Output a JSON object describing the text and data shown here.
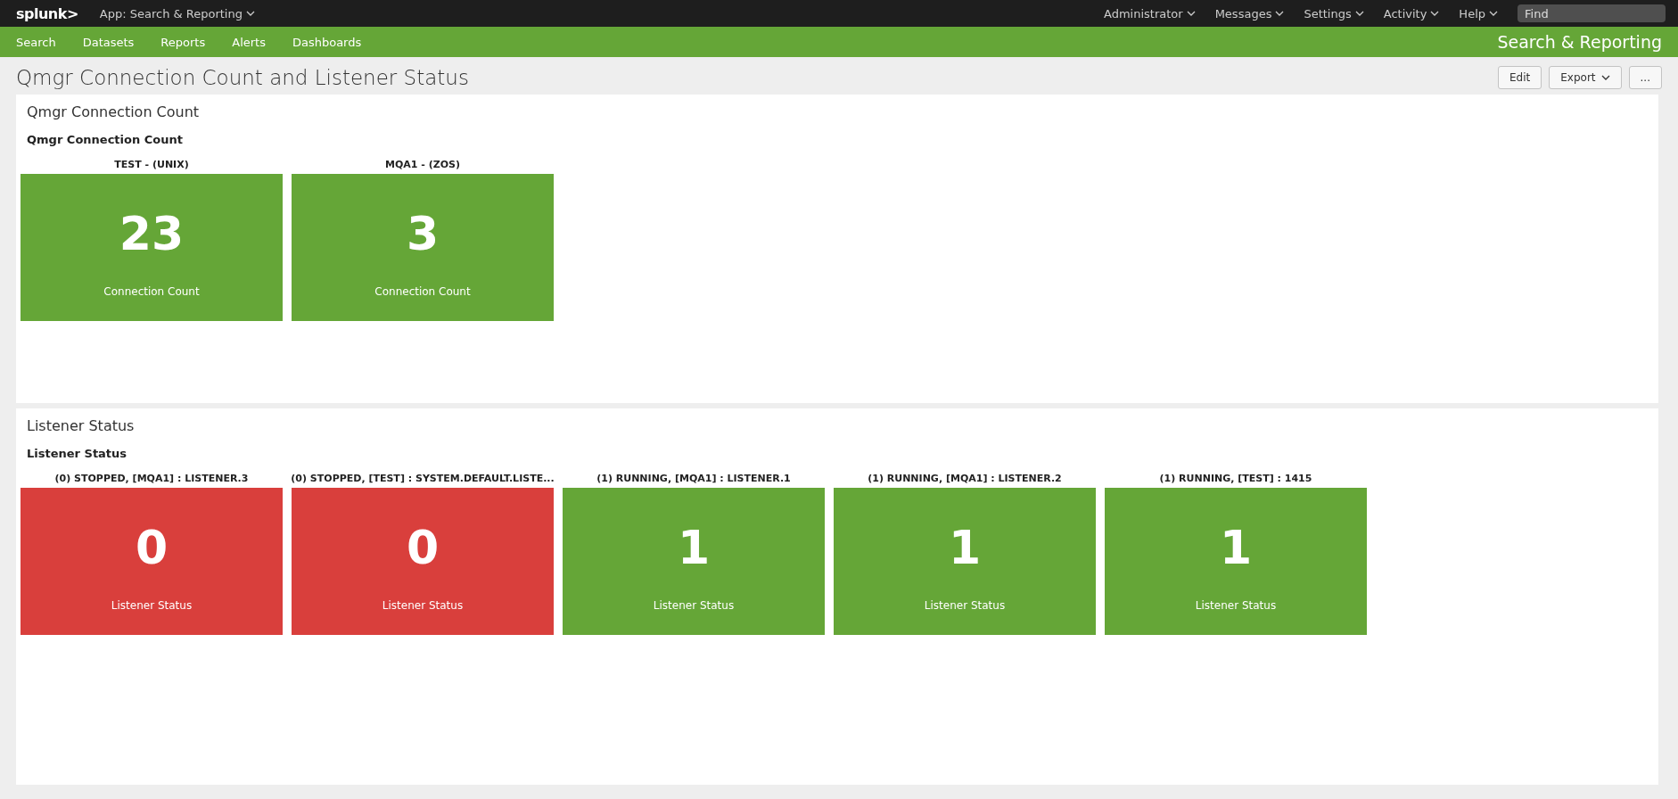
{
  "top_bar": {
    "logo": "splunk>",
    "app_menu": "App: Search & Reporting",
    "menus": [
      "Administrator",
      "Messages",
      "Settings",
      "Activity",
      "Help"
    ],
    "search": {
      "placeholder": "Find"
    }
  },
  "nav": {
    "items": [
      "Search",
      "Datasets",
      "Reports",
      "Alerts",
      "Dashboards"
    ],
    "app_title": "Search & Reporting"
  },
  "dashboard": {
    "title": "Qmgr Connection Count and Listener Status",
    "buttons": [
      {
        "label": "Edit",
        "kind": "plain"
      },
      {
        "label": "Export",
        "kind": "dropdown"
      },
      {
        "label": "...",
        "kind": "plain"
      }
    ]
  },
  "panels": [
    {
      "title": "Qmgr Connection Count",
      "subtitle": "Qmgr Connection Count",
      "tiles": [
        {
          "heading": "TEST - (UNIX)",
          "value": "23",
          "caption": "Connection Count",
          "color": "#65a637"
        },
        {
          "heading": "MQA1 - (ZOS)",
          "value": "3",
          "caption": "Connection Count",
          "color": "#65a637"
        }
      ]
    },
    {
      "title": "Listener Status",
      "subtitle": "Listener Status",
      "tiles": [
        {
          "heading": "(0) STOPPED, [MQA1] : LISTENER.3",
          "value": "0",
          "caption": "Listener Status",
          "color": "#d93f3c"
        },
        {
          "heading": "(0) STOPPED, [TEST] : SYSTEM.DEFAULT.LISTE...",
          "value": "0",
          "caption": "Listener Status",
          "color": "#d93f3c"
        },
        {
          "heading": "(1) RUNNING, [MQA1] : LISTENER.1",
          "value": "1",
          "caption": "Listener Status",
          "color": "#65a637"
        },
        {
          "heading": "(1) RUNNING, [MQA1] : LISTENER.2",
          "value": "1",
          "caption": "Listener Status",
          "color": "#65a637"
        },
        {
          "heading": "(1) RUNNING, [TEST] : 1415",
          "value": "1",
          "caption": "Listener Status",
          "color": "#65a637"
        }
      ]
    }
  ]
}
